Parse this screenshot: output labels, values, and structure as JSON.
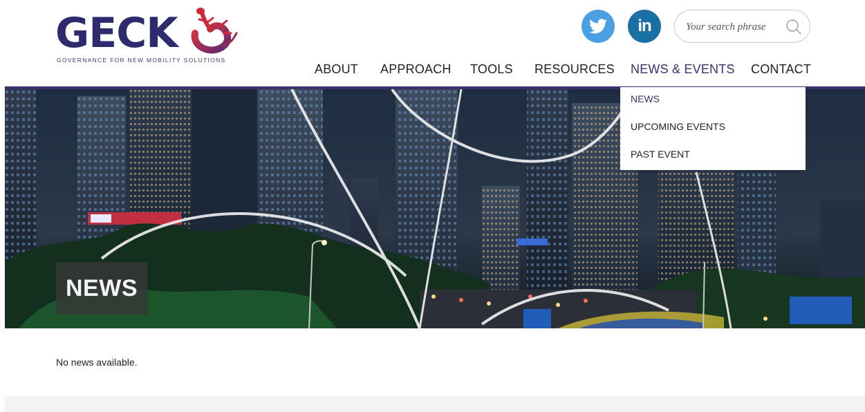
{
  "logo": {
    "wordmark": "GECKO",
    "tagline": "GOVERNANCE FOR NEW MOBILITY SOLUTIONS",
    "brand_color": "#2e2a6e",
    "accent_color": "#d2293a"
  },
  "social": {
    "twitter_icon": "twitter-bird-icon",
    "linkedin_label": "in",
    "twitter_color": "#4aa0e2",
    "linkedin_color": "#1a6fa4"
  },
  "search": {
    "placeholder": "Your search phrase",
    "value": ""
  },
  "nav": {
    "items": [
      "ABOUT",
      "APPROACH",
      "TOOLS",
      "RESOURCES",
      "NEWS & EVENTS",
      "CONTACT"
    ],
    "active": "NEWS & EVENTS",
    "active_color": "#3b2f72"
  },
  "dropdown": {
    "items": [
      "NEWS",
      "UPCOMING EVENTS",
      "PAST EVENT"
    ],
    "active": "NEWS"
  },
  "hero": {
    "title": "NEWS",
    "image": "night-city-skyline"
  },
  "content": {
    "message": "No news available."
  }
}
